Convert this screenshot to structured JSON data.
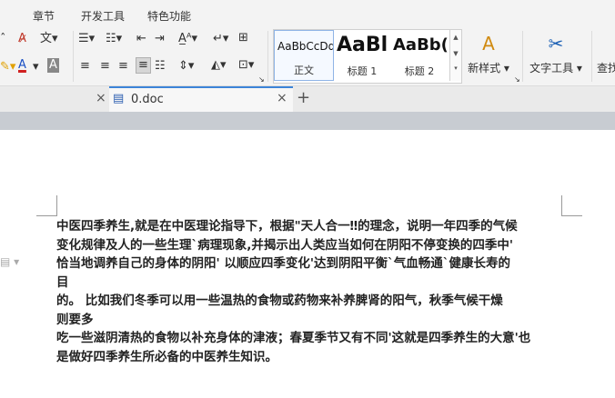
{
  "menu": [
    "章节",
    "开发工具",
    "特色功能"
  ],
  "ribbon": {
    "styles": [
      {
        "preview": "AaBbCcDd",
        "name": "正文"
      },
      {
        "preview": "AaBl",
        "name": "标题 1"
      },
      {
        "preview": "AaBb(",
        "name": "标题 2"
      }
    ],
    "new_style": "新样式",
    "text_tools": "文字工具",
    "find": "查找",
    "icons": [
      "clear-format-icon",
      "pinyin-icon",
      "bullet-list-icon",
      "numbered-list-icon",
      "decrease-indent-icon",
      "increase-indent-icon",
      "font-size-up-icon",
      "sort-icon",
      "table-icon",
      "highlight-icon",
      "font-color-icon",
      "char-shading-icon",
      "align-left-icon",
      "align-center-icon",
      "align-right-icon",
      "justify-icon",
      "distributed-icon",
      "line-spacing-icon",
      "shading-icon",
      "borders-icon"
    ]
  },
  "tabs": {
    "doc_tab": "0.doc",
    "close_glyph": "×",
    "add_glyph": "+"
  },
  "document": {
    "lines": [
      "中医四季养生,就是在中医理论指导下，根据\"天人合一‼的理念，说明一年四季的气候",
      "变化规律及人的一些生理`病理现象,并揭示出人类应当如何在阴阳不停变换的四季中'",
      "恰当地调养自己的身体的阴阳'          以顺应四季变化'达到阴阳平衡`气血畅通`健康长寿的",
      "目",
      "的。           比如我们冬季可以用一些温热的食物或药物来补养脾肾的阳气，秋季气候干燥",
      "则要多",
      "吃一些滋阴清热的食物以补充身体的津液；春夏季节又有不同'这就是四季养生的大意'也",
      "是做好四季养生所必备的中医养生知识。"
    ]
  }
}
